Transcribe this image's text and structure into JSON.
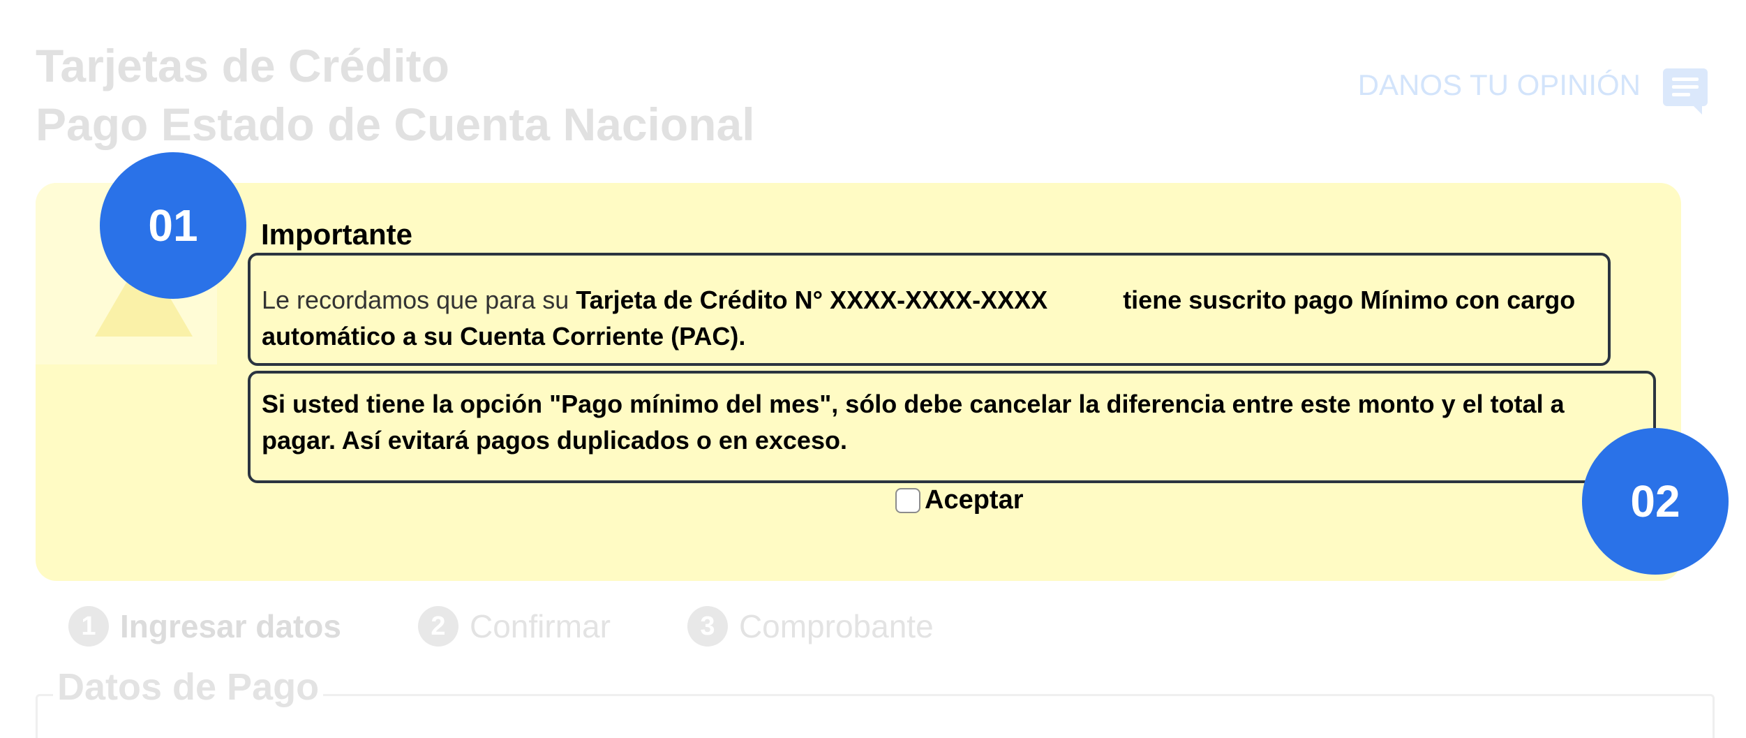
{
  "header": {
    "title_line1": "Tarjetas de Crédito",
    "title_line2": "Pago Estado de Cuenta Nacional",
    "feedback_label": "DANOS TU OPINIÓN"
  },
  "badges": {
    "first": "01",
    "second": "02"
  },
  "notice": {
    "heading": "Importante",
    "line1_prefix": "Le recordamos que para su ",
    "card_label": "Tarjeta de Crédito N° XXXX-XXXX-XXXX",
    "line1_suffix": "tiene suscrito pago Mínimo con cargo automático a su Cuenta Corriente (PAC).",
    "line2": "Si usted tiene la opción \"Pago mínimo del mes\", sólo debe cancelar la diferencia entre este monto y el total a pagar. Así evitará pagos duplicados o en exceso.",
    "accept_label": "Aceptar"
  },
  "steps": [
    {
      "number": "1",
      "label": "Ingresar datos"
    },
    {
      "number": "2",
      "label": "Confirmar"
    },
    {
      "number": "3",
      "label": "Comprobante"
    }
  ],
  "section": {
    "title": "Datos de Pago"
  },
  "colors": {
    "accent": "#2a72e8",
    "panel": "#fffbc4",
    "border": "#2b3440"
  }
}
